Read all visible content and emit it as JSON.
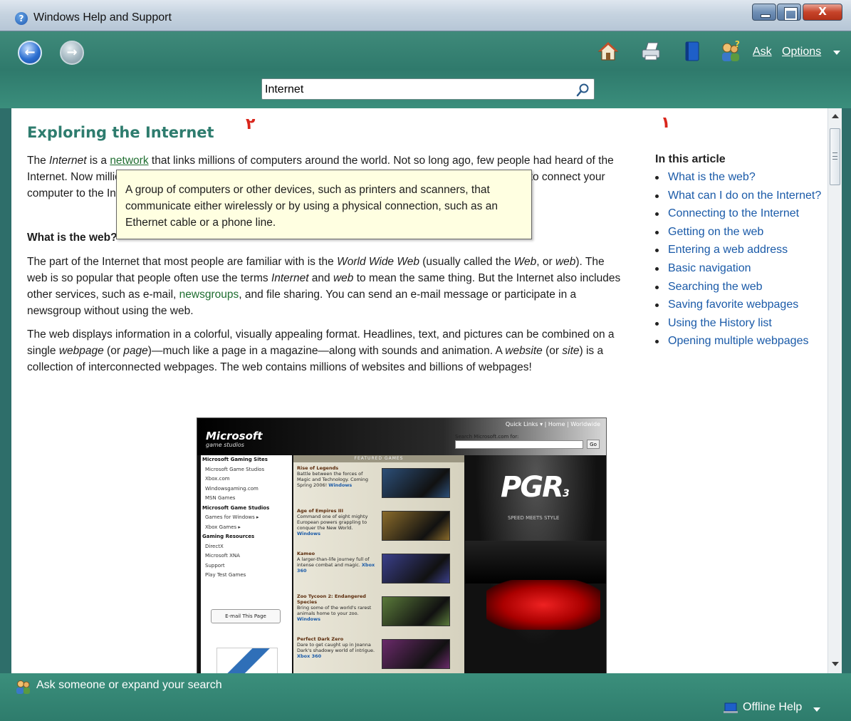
{
  "window": {
    "title": "Windows Help and Support",
    "app_icon_glyph": "?"
  },
  "toolbar": {
    "back_glyph": "←",
    "forward_glyph": "→",
    "ask_label": "Ask",
    "options_label": "Options",
    "icons": [
      "home-icon",
      "print-icon",
      "browse-help-icon",
      "ask-icon"
    ]
  },
  "search": {
    "value": "Internet"
  },
  "markers": {
    "left": "٢",
    "right": "١"
  },
  "article": {
    "title": "Exploring the Internet",
    "p1": {
      "part1": "The ",
      "term_internet": "Internet",
      "part2": " is a ",
      "link_network": "network",
      "part3": " that links millions of computers around the world. Not so long ago, few people had heard of the Internet. Now millions of people depend on it daily to communicate and find information. You can use it to connect your computer to the Internet."
    },
    "heading_what": "What is the web?",
    "p2": {
      "a": "The part of the Internet that most people are familiar with is the ",
      "wwweb": "World Wide Web",
      "b": " (usually called the ",
      "web1": "Web",
      "c": ", or ",
      "web2": "web",
      "d": "). The web is so popular that people often use the terms ",
      "internet": "Internet",
      "e": " and ",
      "web3": "web",
      "f": " to mean the same thing. But the Internet also includes other services, such as e‑mail, ",
      "newsgroups": "newsgroups",
      "g": ", and file sharing. You can send an e‑mail message or participate in a newsgroup without using the web."
    },
    "p3": {
      "a": "The web displays information in a colorful, visually appealing format. Headlines, text, and pictures can be combined on a single ",
      "webpage": "webpage",
      "b": " (or ",
      "page": "page",
      "c": ")—much like a page in a magazine—along with sounds and animation. A ",
      "website": "website",
      "d": " (or ",
      "site": "site",
      "e": ") is a collection of interconnected webpages. The web contains millions of websites and billions of webpages!"
    },
    "tooltip": "A group of computers or other devices, such as printers and scanners, that communicate either wirelessly or by using a physical connection, such as an Ethernet cable or a phone line."
  },
  "embedded_screenshot": {
    "quick_links": "Quick Links ▾  |  Home  |  Worldwide",
    "logo": "Microsoft",
    "logo_sub": "game studios",
    "search_label": "Search Microsoft.com for:",
    "go": "Go",
    "featured": "FEATURED GAMES",
    "left_items": [
      {
        "text": "Microsoft Gaming Sites",
        "head": true
      },
      {
        "text": "Microsoft Game Studios",
        "head": false
      },
      {
        "text": "Xbox.com",
        "head": false
      },
      {
        "text": "Windowsgaming.com",
        "head": false
      },
      {
        "text": "MSN Games",
        "head": false
      },
      {
        "text": "Microsoft Game Studios",
        "head": true
      },
      {
        "text": "Games for Windows  ▸",
        "head": false
      },
      {
        "text": "Xbox Games  ▸",
        "head": false
      },
      {
        "text": "Gaming Resources",
        "head": true
      },
      {
        "text": "DirectX",
        "head": false
      },
      {
        "text": "Microsoft XNA",
        "head": false
      },
      {
        "text": "Support",
        "head": false
      },
      {
        "text": "Play Test Games",
        "head": false
      }
    ],
    "email_button": "E-mail This Page",
    "games": [
      {
        "title": "Rise of Legends",
        "desc": "Battle between the forces of Magic and Technology. Coming Spring 2006!",
        "platform": "Windows",
        "color": "#2c4f78"
      },
      {
        "title": "Age of Empires III",
        "desc": "Command one of eight mighty European powers grappling to conquer the New World.",
        "platform": "Windows",
        "color": "#8a6b2a"
      },
      {
        "title": "Kameo",
        "desc": "A larger-than-life journey full of intense combat and magic.",
        "platform": "Xbox 360",
        "color": "#3a3f8a"
      },
      {
        "title": "Zoo Tycoon 2: Endangered Species",
        "desc": "Bring some of the world's rarest animals home to your zoo.",
        "platform": "Windows",
        "color": "#5a7a3a"
      },
      {
        "title": "Perfect Dark Zero",
        "desc": "Dare to get caught up in Joanna Dark's shadowy world of intrigue.",
        "platform": "Xbox 360",
        "color": "#6a2a6a"
      }
    ],
    "pgr": "PGR",
    "pgr_number": "3",
    "pgr_tag": "SPEED MEETS STYLE"
  },
  "sidebar": {
    "heading": "In this article",
    "items": [
      "What is the web?",
      "What can I do on the Internet?",
      "Connecting to the Internet",
      "Getting on the web",
      "Entering a web address",
      "Basic navigation",
      "Searching the web",
      "Saving favorite webpages",
      "Using the History list",
      "Opening multiple webpages"
    ]
  },
  "statusbar": {
    "ask_label": "Ask someone or expand your search",
    "offline_label": "Offline Help"
  }
}
